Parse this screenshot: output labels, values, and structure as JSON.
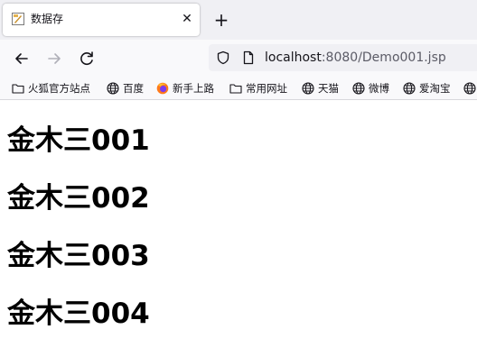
{
  "tab": {
    "title": "数据存",
    "close_icon": "close-icon",
    "favicon_icon": "page-favicon-icon"
  },
  "new_tab_icon": "plus-icon",
  "nav": {
    "back_icon": "back-arrow-icon",
    "forward_icon": "forward-arrow-icon",
    "reload_icon": "reload-icon"
  },
  "url": {
    "host": "localhost",
    "rest": ":8080/Demo001.jsp"
  },
  "bookmarks": [
    {
      "label": "火狐官方站点",
      "icon": "folder-icon"
    },
    {
      "label": "百度",
      "icon": "globe-icon"
    },
    {
      "label": "新手上路",
      "icon": "firefox-icon"
    },
    {
      "label": "常用网址",
      "icon": "folder-icon"
    },
    {
      "label": "天猫",
      "icon": "globe-icon"
    },
    {
      "label": "微博",
      "icon": "globe-icon"
    },
    {
      "label": "爱淘宝",
      "icon": "globe-icon"
    },
    {
      "label": "",
      "icon": "globe-icon"
    }
  ],
  "headings": [
    "金木三001",
    "金木三002",
    "金木三003",
    "金木三004"
  ]
}
